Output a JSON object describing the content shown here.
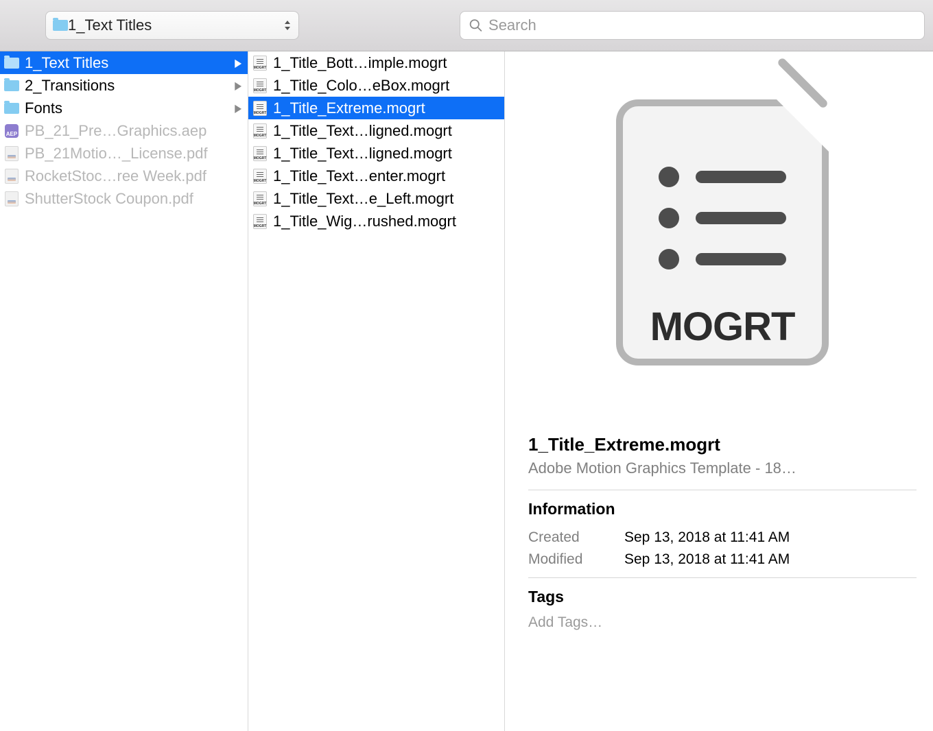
{
  "toolbar": {
    "path_label": "1_Text Titles",
    "search_placeholder": "Search"
  },
  "column1": [
    {
      "type": "folder",
      "label": "1_Text Titles",
      "selected": true,
      "expandable": true
    },
    {
      "type": "folder",
      "label": "2_Transitions",
      "expandable": true
    },
    {
      "type": "folder",
      "label": "Fonts",
      "expandable": true
    },
    {
      "type": "aep",
      "label": "PB_21_Pre…Graphics.aep",
      "dim": true
    },
    {
      "type": "pdf",
      "label": "PB_21Motio…_License.pdf",
      "dim": true
    },
    {
      "type": "pdf",
      "label": "RocketStoc…ree Week.pdf",
      "dim": true
    },
    {
      "type": "pdf",
      "label": "ShutterStock Coupon.pdf",
      "dim": true
    }
  ],
  "column2": [
    {
      "label": "1_Title_Bott…imple.mogrt"
    },
    {
      "label": "1_Title_Colo…eBox.mogrt"
    },
    {
      "label": "1_Title_Extreme.mogrt",
      "selected": true
    },
    {
      "label": "1_Title_Text…ligned.mogrt"
    },
    {
      "label": "1_Title_Text…ligned.mogrt"
    },
    {
      "label": "1_Title_Text…enter.mogrt"
    },
    {
      "label": "1_Title_Text…e_Left.mogrt"
    },
    {
      "label": "1_Title_Wig…rushed.mogrt"
    }
  ],
  "preview": {
    "icon_label": "MOGRT",
    "title": "1_Title_Extreme.mogrt",
    "subtitle": "Adobe Motion Graphics Template - 18…",
    "info_heading": "Information",
    "created_label": "Created",
    "created_value": "Sep 13, 2018 at 11:41 AM",
    "modified_label": "Modified",
    "modified_value": "Sep 13, 2018 at 11:41 AM",
    "tags_heading": "Tags",
    "tags_placeholder": "Add Tags…"
  }
}
